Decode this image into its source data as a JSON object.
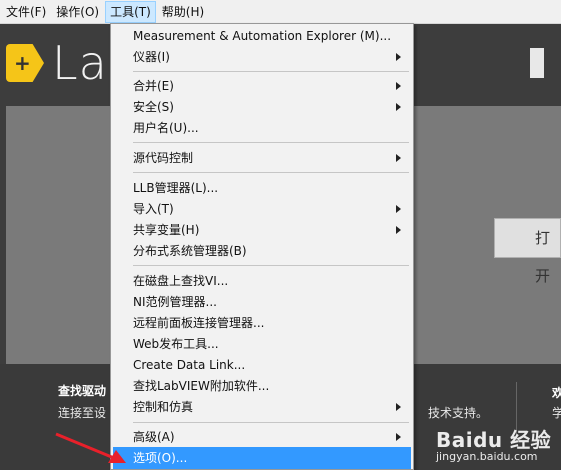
{
  "menubar": {
    "items": [
      {
        "label": "文件(F)"
      },
      {
        "label": "操作(O)"
      },
      {
        "label": "工具(T)"
      },
      {
        "label": "帮助(H)"
      }
    ]
  },
  "background": {
    "brand_text": "Lab",
    "logo_glyph": "+",
    "open_button": "打开",
    "bottom_title": "查找驱动",
    "bottom_sub": "连接至设",
    "bottom_sub2": "技术支持。",
    "bottom_right_title": "欢",
    "bottom_right_sub": "学"
  },
  "tools_menu": {
    "items": [
      {
        "label": "Measurement & Automation Explorer (M)...",
        "submenu": false
      },
      {
        "label": "仪器(I)",
        "submenu": true
      },
      {
        "label": "合并(E)",
        "submenu": true
      },
      {
        "label": "安全(S)",
        "submenu": true
      },
      {
        "label": "用户名(U)...",
        "submenu": false
      },
      {
        "label": "源代码控制",
        "submenu": true
      },
      {
        "label": "LLB管理器(L)...",
        "submenu": false
      },
      {
        "label": "导入(T)",
        "submenu": true
      },
      {
        "label": "共享变量(H)",
        "submenu": true
      },
      {
        "label": "分布式系统管理器(B)",
        "submenu": false
      },
      {
        "label": "在磁盘上查找VI...",
        "submenu": false
      },
      {
        "label": "NI范例管理器...",
        "submenu": false
      },
      {
        "label": "远程前面板连接管理器...",
        "submenu": false
      },
      {
        "label": "Web发布工具...",
        "submenu": false
      },
      {
        "label": "Create Data Link...",
        "submenu": false
      },
      {
        "label": "查找LabVIEW附加软件...",
        "submenu": false
      },
      {
        "label": "控制和仿真",
        "submenu": true
      },
      {
        "label": "高级(A)",
        "submenu": true
      },
      {
        "label": "选项(O)...",
        "submenu": false,
        "highlighted": true
      }
    ]
  },
  "watermark": {
    "brand": "Baidu 经验",
    "url": "jingyan.baidu.com"
  },
  "colors": {
    "highlight": "#3399ff",
    "menubar_active": "#cce8ff",
    "annotation_arrow": "#e8202a",
    "logo": "#f5c518"
  }
}
